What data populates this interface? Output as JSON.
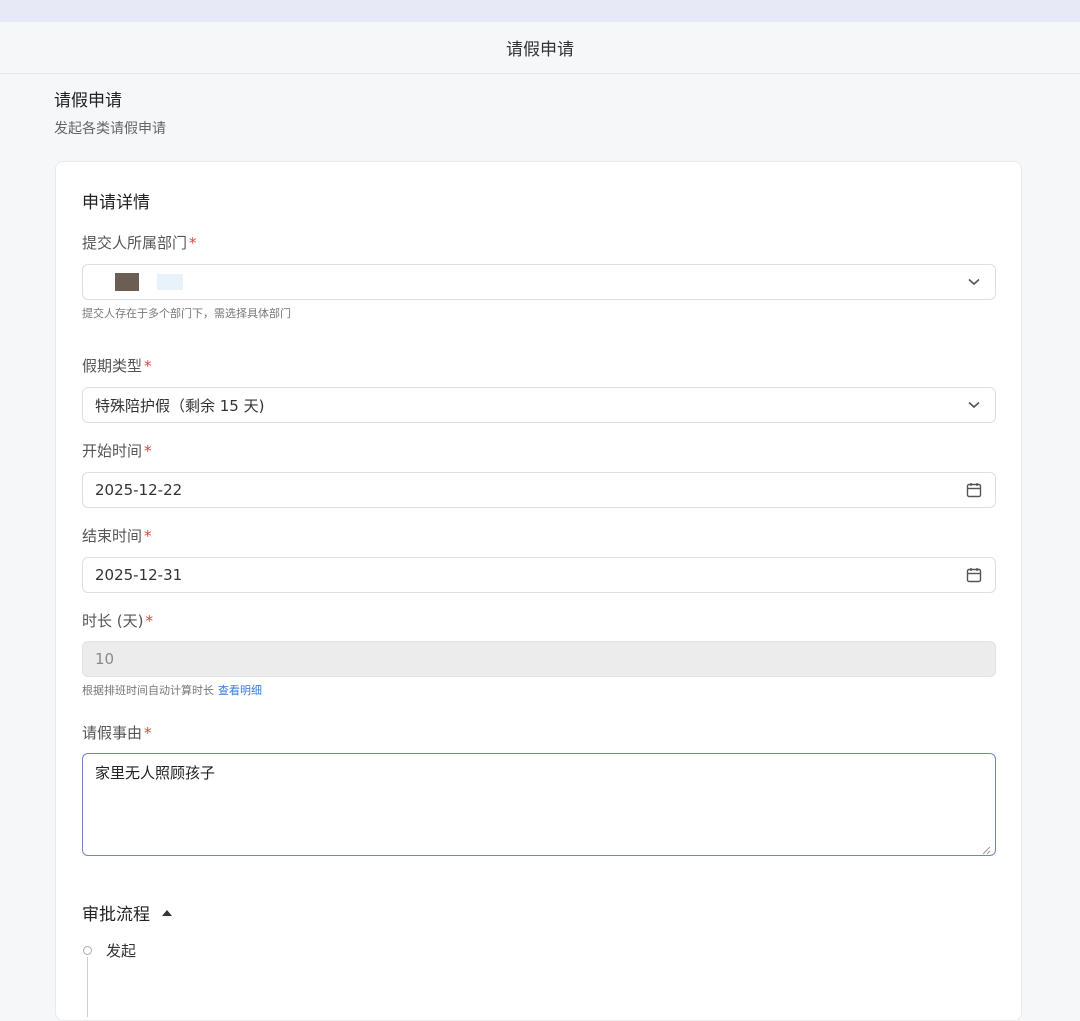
{
  "nav": {
    "title": "请假申请"
  },
  "page": {
    "title": "请假申请",
    "subtitle": "发起各类请假申请"
  },
  "form": {
    "section_title": "申请详情",
    "department": {
      "label": "提交人所属部门",
      "required_mark": "*",
      "hint": "提交人存在于多个部门下，需选择具体部门",
      "icon": "chevron-down-icon"
    },
    "leave_type": {
      "label": "假期类型",
      "required_mark": "*",
      "value": "特殊陪护假（剩余 15 天)",
      "icon": "chevron-down-icon"
    },
    "start_time": {
      "label": "开始时间",
      "required_mark": "*",
      "value": "2025-12-22",
      "icon": "calendar-icon"
    },
    "end_time": {
      "label": "结束时间",
      "required_mark": "*",
      "value": "2025-12-31",
      "icon": "calendar-icon"
    },
    "duration": {
      "label": "时长 (天)",
      "required_mark": "*",
      "value": "10",
      "hint": "根据排班时间自动计算时长",
      "hint_link": "查看明细"
    },
    "reason": {
      "label": "请假事由",
      "required_mark": "*",
      "value": "家里无人照顾孩子"
    }
  },
  "approval": {
    "title": "审批流程",
    "steps": [
      {
        "label": "发起"
      }
    ]
  },
  "colors": {
    "required": "#d4463b",
    "link": "#3a7bd5",
    "focus_border": "#6e86c4"
  }
}
